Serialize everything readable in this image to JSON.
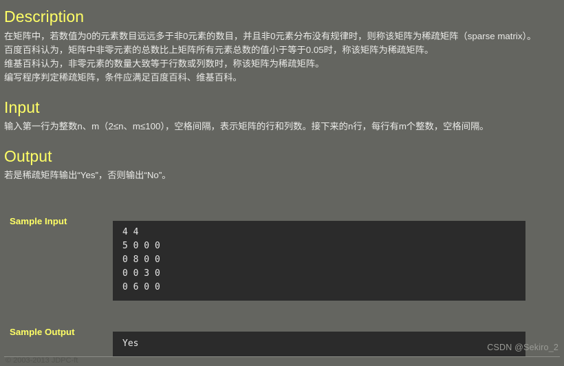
{
  "theme": {
    "background": "#646560",
    "heading_color": "#ffff66",
    "body_text_color": "#e9e9e6",
    "code_background": "#2b2b2b",
    "code_text_color": "#e6e6e6",
    "footer_text_color": "#545550",
    "watermark_color": "#9a9b96",
    "rule_color": "#8c8d88"
  },
  "sections": {
    "description": {
      "heading": "Description",
      "lines": [
        "在矩阵中，若数值为0的元素数目远远多于非0元素的数目，并且非0元素分布没有规律时，则称该矩阵为稀疏矩阵（sparse matrix）。",
        "百度百科认为，矩阵中非零元素的总数比上矩阵所有元素总数的值小于等于0.05时，称该矩阵为稀疏矩阵。",
        "维基百科认为，非零元素的数量大致等于行数或列数时，称该矩阵为稀疏矩阵。",
        "编写程序判定稀疏矩阵，条件应满足百度百科、维基百科。"
      ]
    },
    "input": {
      "heading": "Input",
      "text": "输入第一行为整数n、m（2≤n、m≤100），空格间隔，表示矩阵的行和列数。接下来的n行，每行有m个整数，空格间隔。"
    },
    "output": {
      "heading": "Output",
      "text": "若是稀疏矩阵输出“Yes”，否则输出“No”。"
    },
    "sample_input": {
      "label": "Sample Input",
      "code": "4 4\n5 0 0 0\n0 8 0 0\n0 0 3 0\n0 6 0 0"
    },
    "sample_output": {
      "label": "Sample Output",
      "code": "Yes"
    }
  },
  "footer": {
    "copyright": "© 2003-2013 JDPC-ft",
    "watermark": "CSDN @Sekiro_2"
  }
}
